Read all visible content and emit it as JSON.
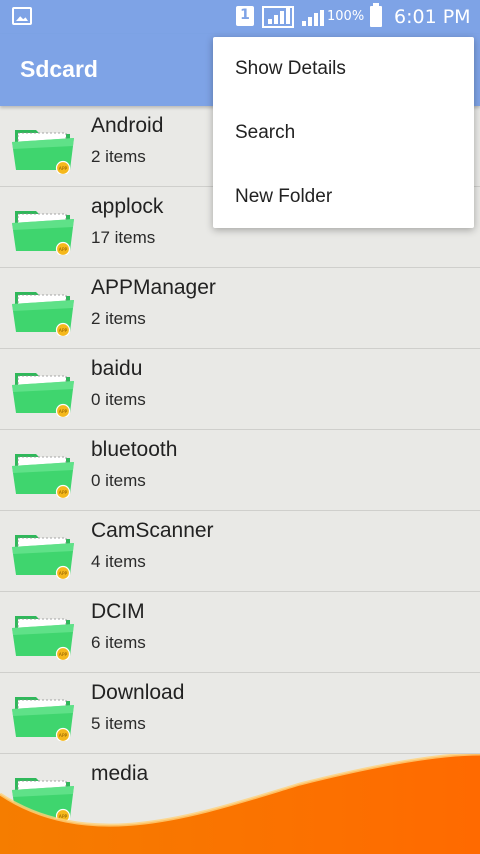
{
  "status_bar": {
    "sim_number": "1",
    "battery_percent": "100%",
    "time": "6:01 PM",
    "icons": [
      "gallery-icon",
      "sim-icon",
      "signal-icon",
      "signal-icon",
      "battery-icon"
    ]
  },
  "app_bar": {
    "title": "Sdcard"
  },
  "menu": {
    "items": [
      {
        "label": "Show Details"
      },
      {
        "label": "Search"
      },
      {
        "label": "New Folder"
      }
    ]
  },
  "folders": [
    {
      "name": "Android",
      "count": "2 items"
    },
    {
      "name": "applock",
      "count": "17 items"
    },
    {
      "name": "APPManager",
      "count": "2 items"
    },
    {
      "name": "baidu",
      "count": "0 items"
    },
    {
      "name": "bluetooth",
      "count": "0 items"
    },
    {
      "name": "CamScanner",
      "count": "4 items"
    },
    {
      "name": "DCIM",
      "count": "6 items"
    },
    {
      "name": "Download",
      "count": "5 items"
    },
    {
      "name": "media",
      "count": ""
    }
  ],
  "colors": {
    "app_bar": "#7ea3e6",
    "folder_green": "#3fd56e",
    "badge_orange": "#f5b81c",
    "wave_orange": "#ff7a00"
  }
}
